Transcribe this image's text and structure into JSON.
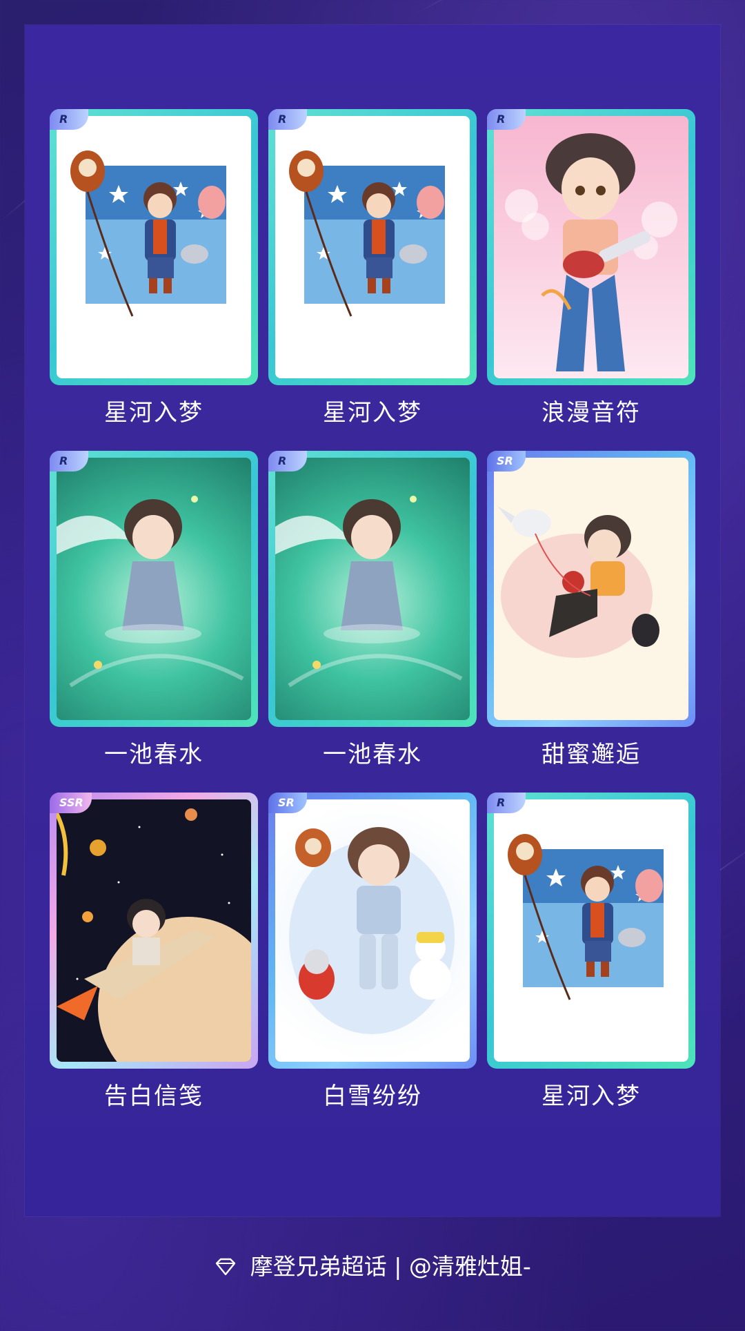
{
  "cards": [
    {
      "rarity": "R",
      "title": "星河入梦",
      "theme": "star-river"
    },
    {
      "rarity": "R",
      "title": "星河入梦",
      "theme": "star-river"
    },
    {
      "rarity": "R",
      "title": "浪漫音符",
      "theme": "guitar"
    },
    {
      "rarity": "R",
      "title": "一池春水",
      "theme": "spring-water"
    },
    {
      "rarity": "R",
      "title": "一池春水",
      "theme": "spring-water"
    },
    {
      "rarity": "SR",
      "title": "甜蜜邂逅",
      "theme": "sweet"
    },
    {
      "rarity": "SSR",
      "title": "告白信笺",
      "theme": "space"
    },
    {
      "rarity": "SR",
      "title": "白雪纷纷",
      "theme": "snow"
    },
    {
      "rarity": "R",
      "title": "星河入梦",
      "theme": "star-river"
    }
  ],
  "footer": {
    "text": "摩登兄弟超话 | @清雅灶姐-",
    "icon": "gem-icon"
  },
  "colors": {
    "bg": "#2f1f7c",
    "panel": "#3a2899",
    "r_frame": "#4fd9cc",
    "sr_frame": "#6aa8f2",
    "ssr_frame": "#d3a6ef"
  }
}
